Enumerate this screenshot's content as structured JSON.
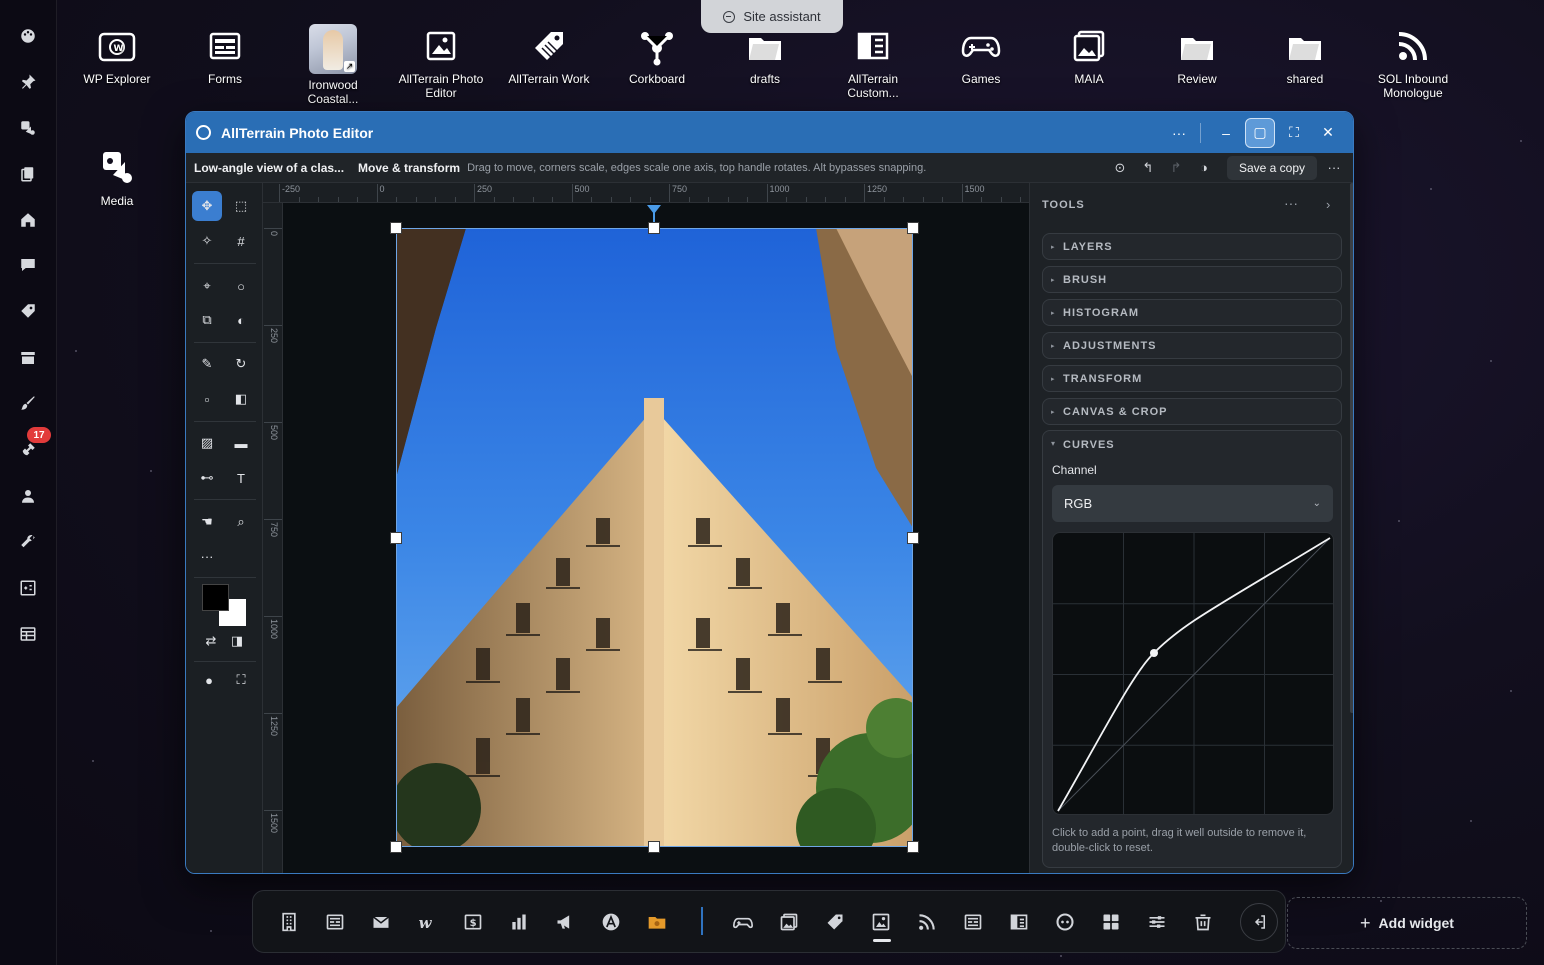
{
  "site_assistant": {
    "label": "Site assistant"
  },
  "desktop_icons": [
    {
      "label": "WP Explorer",
      "icon": "wordpress-folder-icon"
    },
    {
      "label": "Forms",
      "icon": "form-icon"
    },
    {
      "label": "Ironwood Coastal...",
      "icon": "shortcut-thumbnail"
    },
    {
      "label": "AllTerrain Photo Editor",
      "icon": "photo-editor-icon"
    },
    {
      "label": "AllTerrain Work",
      "icon": "tag-icon"
    },
    {
      "label": "Corkboard",
      "icon": "corkboard-icon"
    },
    {
      "label": "drafts",
      "icon": "folder-icon"
    },
    {
      "label": "AllTerrain Custom...",
      "icon": "layout-icon"
    },
    {
      "label": "Games",
      "icon": "gamepad-icon"
    },
    {
      "label": "MAIA",
      "icon": "gallery-icon"
    },
    {
      "label": "Review",
      "icon": "folder-icon"
    },
    {
      "label": "shared",
      "icon": "folder-icon"
    },
    {
      "label": "SOL Inbound Monologue",
      "icon": "rss-icon"
    },
    {
      "label": "Media",
      "icon": "media-icon"
    }
  ],
  "left_dock": {
    "badge": "17",
    "items": [
      "palette-icon",
      "pin-icon",
      "media-icon",
      "copy-icon",
      "home-icon",
      "comment-icon",
      "tag-icon",
      "archive-icon",
      "brush-icon",
      "plugin-icon",
      "user-icon",
      "wrench-icon",
      "widgets-icon",
      "table-icon"
    ]
  },
  "window": {
    "title": "AllTerrain Photo Editor",
    "toolbar": {
      "file_label": "Low-angle view of a clas...",
      "mode_label": "Move & transform",
      "hint": "Drag to move, corners scale, edges scale one axis, top handle rotates. Alt bypasses snapping.",
      "save_label": "Save a copy"
    },
    "ruler_top": [
      "-250",
      "0",
      "250",
      "500",
      "750",
      "1000",
      "1250",
      "1500"
    ],
    "ruler_left": [
      "0",
      "250",
      "500",
      "750",
      "1000",
      "1250",
      "1500"
    ],
    "panel": {
      "header": "TOOLS",
      "sections": [
        "LAYERS",
        "BRUSH",
        "HISTOGRAM",
        "ADJUSTMENTS",
        "TRANSFORM",
        "CANVAS & CROP"
      ],
      "curves": {
        "title": "CURVES",
        "channel_label": "Channel",
        "channel_value": "RGB",
        "hint": "Click to add a point, drag it well outside to remove it, double-click to reset."
      }
    }
  },
  "bottom_dock": {
    "items": [
      "building-icon",
      "form-icon",
      "mail-icon",
      "w-icon",
      "dollar-icon",
      "chart-icon",
      "megaphone-icon",
      "a-logo-icon",
      "folder-app-icon",
      "gamepad-icon",
      "gallery-icon",
      "tag-icon",
      "photo-editor-icon",
      "rss-icon",
      "form-icon",
      "layout-icon",
      "dial-icon",
      "grid-icon",
      "sliders-icon",
      "trash-icon"
    ],
    "active": "photo-editor-icon",
    "add_widget_label": "Add widget"
  }
}
